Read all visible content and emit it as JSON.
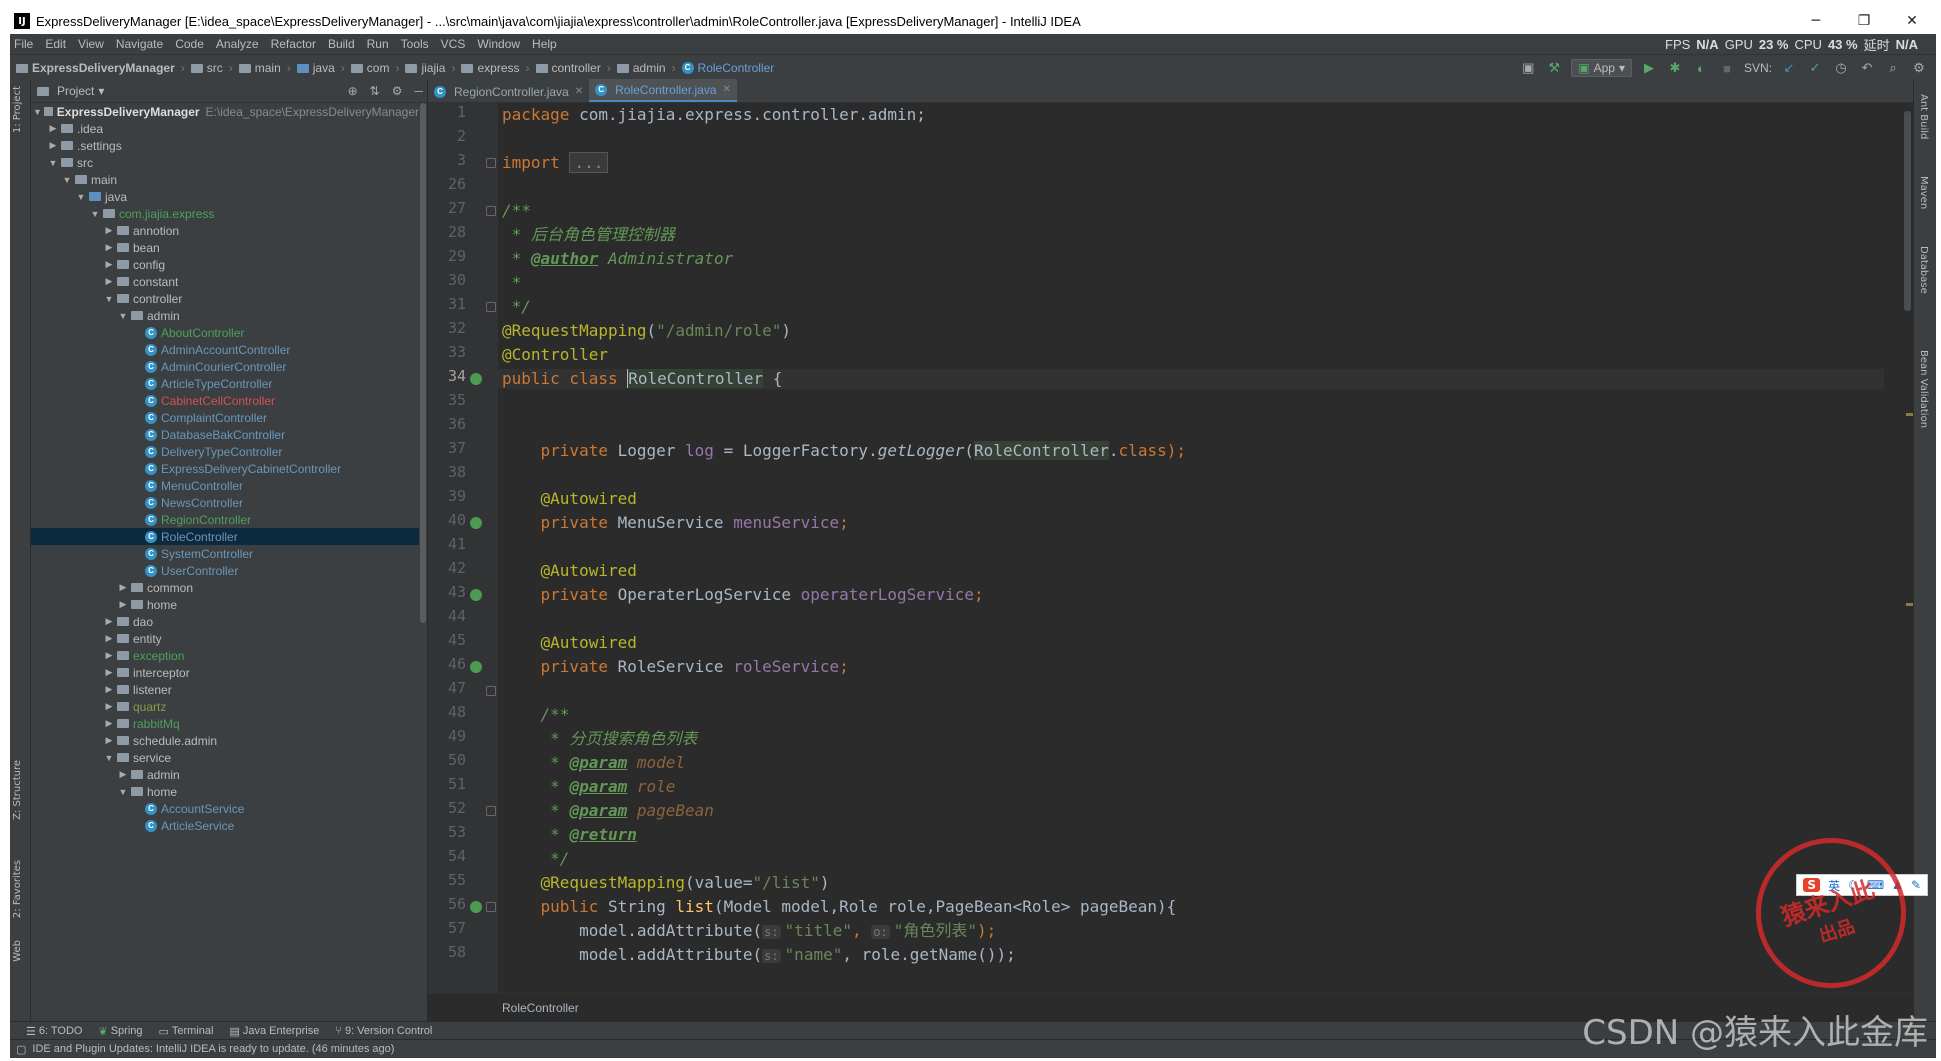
{
  "window": {
    "title": "ExpressDeliveryManager [E:\\idea_space\\ExpressDeliveryManager] - ...\\src\\main\\java\\com\\jiajia\\express\\controller\\admin\\RoleController.java [ExpressDeliveryManager] - IntelliJ IDEA",
    "minimize": "─",
    "maximize": "❐",
    "close": "✕"
  },
  "menu": [
    "File",
    "Edit",
    "View",
    "Navigate",
    "Code",
    "Analyze",
    "Refactor",
    "Build",
    "Run",
    "Tools",
    "VCS",
    "Window",
    "Help"
  ],
  "stats": {
    "fps": "FPS",
    "fps_val": "N/A",
    "gpu": "GPU",
    "gpu_val": "23 %",
    "cpu": "CPU",
    "cpu_val": "43 %",
    "delay": "延时",
    "delay_val": "N/A"
  },
  "breadcrumbs": [
    "ExpressDeliveryManager",
    "src",
    "main",
    "java",
    "com",
    "jiajia",
    "express",
    "controller",
    "admin",
    "RoleController"
  ],
  "toolbar": {
    "run_config": "App",
    "svn": "SVN:"
  },
  "left_tabs": {
    "project": "1: Project",
    "structure": "Z: Structure",
    "favorites": "2: Favorites",
    "web": "Web"
  },
  "right_tabs": {
    "ant": "Ant Build",
    "maven": "Maven",
    "database": "Database",
    "bean": "Bean Validation"
  },
  "project_panel": {
    "title": "Project"
  },
  "tree": [
    {
      "label": "ExpressDeliveryManager",
      "path": "E:\\idea_space\\ExpressDeliveryManager",
      "style": "bold"
    },
    {
      "label": ".idea"
    },
    {
      "label": ".settings"
    },
    {
      "label": "src"
    },
    {
      "label": "main"
    },
    {
      "label": "java"
    },
    {
      "label": "com.jiajia.express",
      "style": "green"
    },
    {
      "label": "annotion"
    },
    {
      "label": "bean"
    },
    {
      "label": "config"
    },
    {
      "label": "constant"
    },
    {
      "label": "controller"
    },
    {
      "label": "admin"
    },
    {
      "label": "AboutController",
      "style": "green"
    },
    {
      "label": "AdminAccountController",
      "style": "blue"
    },
    {
      "label": "AdminCourierController",
      "style": "blue"
    },
    {
      "label": "ArticleTypeController",
      "style": "blue"
    },
    {
      "label": "CabinetCellController",
      "style": "red"
    },
    {
      "label": "ComplaintController",
      "style": "blue"
    },
    {
      "label": "DatabaseBakController",
      "style": "blue"
    },
    {
      "label": "DeliveryTypeController",
      "style": "blue"
    },
    {
      "label": "ExpressDeliveryCabinetController",
      "style": "blue"
    },
    {
      "label": "MenuController",
      "style": "blue"
    },
    {
      "label": "NewsController",
      "style": "blue"
    },
    {
      "label": "RegionController",
      "style": "green"
    },
    {
      "label": "RoleController",
      "style": "blue"
    },
    {
      "label": "SystemController",
      "style": "blue"
    },
    {
      "label": "UserController",
      "style": "blue"
    },
    {
      "label": "common"
    },
    {
      "label": "home"
    },
    {
      "label": "dao"
    },
    {
      "label": "entity"
    },
    {
      "label": "exception",
      "style": "green"
    },
    {
      "label": "interceptor"
    },
    {
      "label": "listener"
    },
    {
      "label": "quartz",
      "style": "olive"
    },
    {
      "label": "rabbitMq",
      "style": "green"
    },
    {
      "label": "schedule.admin"
    },
    {
      "label": "service"
    },
    {
      "label": "admin"
    },
    {
      "label": "home"
    },
    {
      "label": "AccountService",
      "style": "blue"
    },
    {
      "label": "ArticleService",
      "style": "blue"
    }
  ],
  "tabs": [
    {
      "label": "RegionController.java"
    },
    {
      "label": "RoleController.java"
    }
  ],
  "line_numbers": [
    "1",
    "2",
    "3",
    "26",
    "27",
    "28",
    "29",
    "30",
    "31",
    "32",
    "33",
    "34",
    "35",
    "36",
    "37",
    "38",
    "39",
    "40",
    "41",
    "42",
    "43",
    "44",
    "45",
    "46",
    "47",
    "48",
    "49",
    "50",
    "51",
    "52",
    "53",
    "54",
    "55",
    "56",
    "57",
    "58"
  ],
  "editor_breadcrumb": "RoleController",
  "code": {
    "pkg_kw": "package",
    "pkg_name": " com.jiajia.express.controller.admin;",
    "import_kw": "import",
    "import_fold": "...",
    "doc1_open": "/**",
    "doc1_l1": " * 后台角色管理控制器",
    "doc1_star": " * ",
    "doc1_author_tag": "@author",
    "doc1_author_val": " Administrator",
    "doc1_blank": " *",
    "doc1_close": " */",
    "rm1_ann": "@RequestMapping",
    "rm1_open": "(",
    "rm1_str": "\"/admin/role\"",
    "rm1_close": ")",
    "ctrl_ann": "@Controller",
    "class_kw": "public class ",
    "class_name": "RoleController",
    "class_brace": " {",
    "log_kw": "private ",
    "log_type": "Logger ",
    "log_field": "log",
    "log_eq": " = LoggerFactory.",
    "log_method": "getLogger",
    "log_paren": "(",
    "log_cls": "RoleController",
    "log_dot": ".",
    "log_class_kw": "class",
    "log_end": ");",
    "aw": "@Autowired",
    "f1_kw": "private ",
    "f1_type": "MenuService ",
    "f1_name": "menuService",
    "f1_end": ";",
    "f2_kw": "private ",
    "f2_type": "OperaterLogService ",
    "f2_name": "operaterLogService",
    "f2_end": ";",
    "f3_kw": "private ",
    "f3_type": "RoleService ",
    "f3_name": "roleService",
    "f3_end": ";",
    "doc2_open": "/**",
    "doc2_l1": " * 分页搜索角色列表",
    "doc2_star": " * ",
    "p1_tag": "@param",
    "p1_val": " model",
    "p2_tag": "@param",
    "p2_val": " role",
    "p3_tag": "@param",
    "p3_val": " pageBean",
    "r_tag": "@return",
    "doc2_close": " */",
    "rm2_ann": "@RequestMapping",
    "rm2_open": "(value=",
    "rm2_str": "\"/list\"",
    "rm2_close": ")",
    "m_kw": "public ",
    "m_type": "String ",
    "m_name": "list",
    "m_params": "(Model model,Role role,PageBean<Role> pageBean){",
    "a1_pre": "model.addAttribute(",
    "a1_hint_s": "s:",
    "a1_str1": "\"title\"",
    "a1_comma": ", ",
    "a1_hint_o": "o:",
    "a1_str2": "\"角色列表\"",
    "a1_end": ");",
    "a2_pre": "model.addAttribute(",
    "a2_hint_s": "s:",
    "a2_str1": "\"name\"",
    "a2_rest": ", role.getName());"
  },
  "bottom_tabs": [
    "6: TODO",
    "Spring",
    "Terminal",
    "Java Enterprise",
    "9: Version Control"
  ],
  "status_message": "IDE and Plugin Updates: IntelliJ IDEA is ready to update. (46 minutes ago)",
  "watermark": "CSDN @猿来入此金库",
  "stamp": {
    "line1": "猿来入此",
    "line2": "出品"
  },
  "ime": {
    "logo": "S",
    "lang": "英"
  }
}
